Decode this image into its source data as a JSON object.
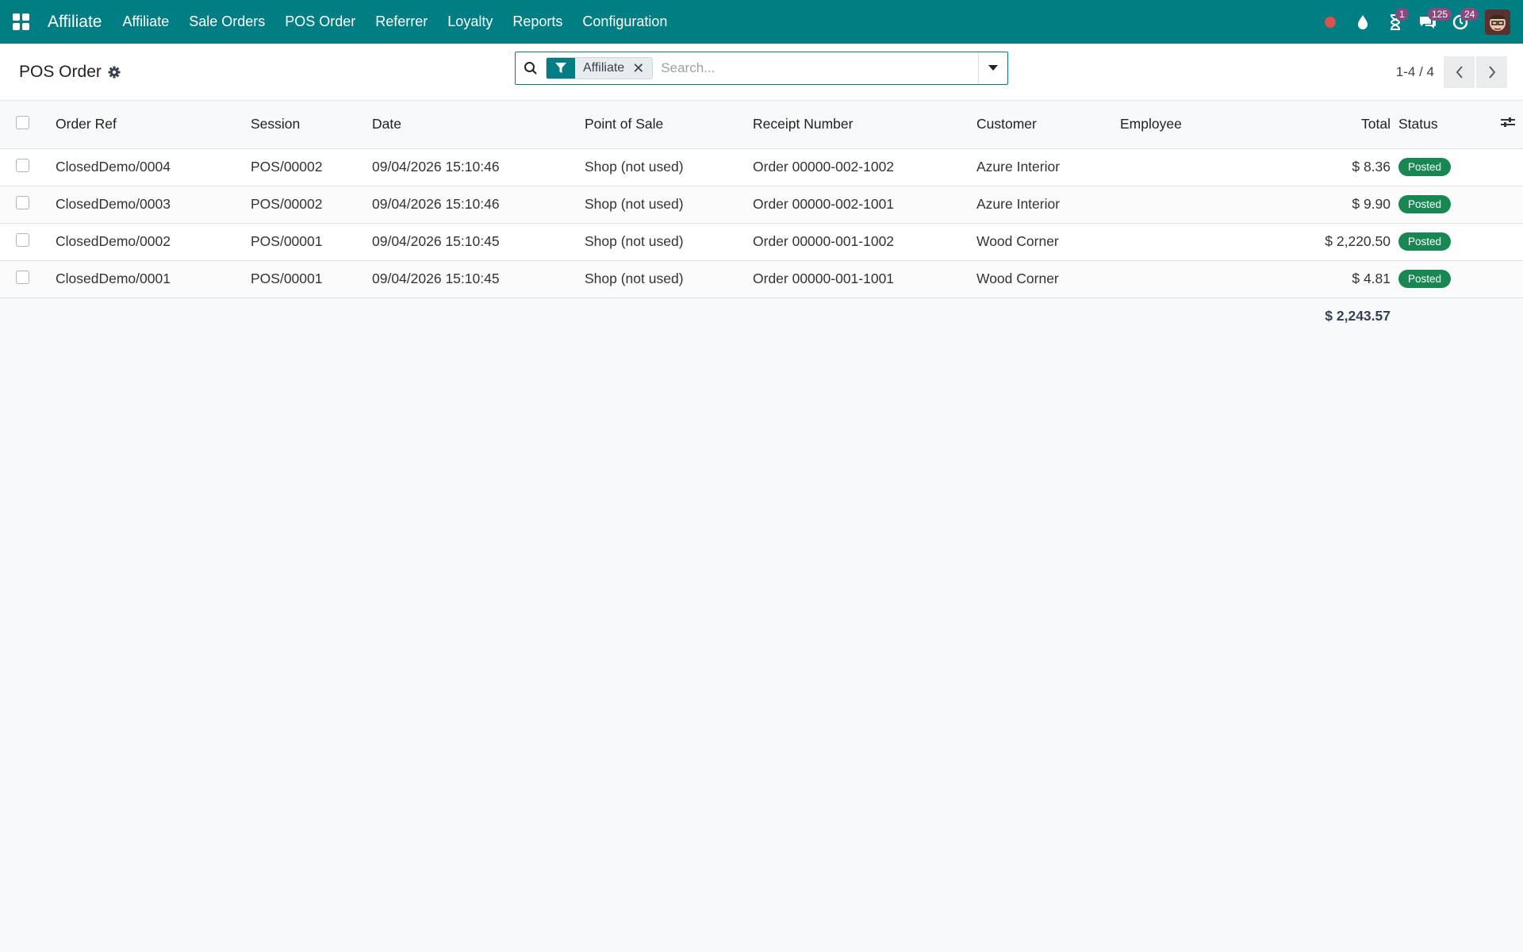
{
  "navbar": {
    "brand": "Affiliate",
    "menu": [
      "Affiliate",
      "Sale Orders",
      "POS Order",
      "Referrer",
      "Loyalty",
      "Reports",
      "Configuration"
    ],
    "activity_badge": "1",
    "messages_badge": "125",
    "activities_badge": "24"
  },
  "control": {
    "title": "POS Order",
    "facet_label": "Affiliate",
    "facet_remove": "✕",
    "search_placeholder": "Search...",
    "pager": "1-4 / 4"
  },
  "table": {
    "columns": [
      "Order Ref",
      "Session",
      "Date",
      "Point of Sale",
      "Receipt Number",
      "Customer",
      "Employee",
      "Total",
      "Status"
    ],
    "rows": [
      {
        "ref": "ClosedDemo/0004",
        "session": "POS/00002",
        "date": "09/04/2026 15:10:46",
        "pos": "Shop (not used)",
        "receipt": "Order 00000-002-1002",
        "customer": "Azure Interior",
        "employee": "",
        "total": "$ 8.36",
        "status": "Posted"
      },
      {
        "ref": "ClosedDemo/0003",
        "session": "POS/00002",
        "date": "09/04/2026 15:10:46",
        "pos": "Shop (not used)",
        "receipt": "Order 00000-002-1001",
        "customer": "Azure Interior",
        "employee": "",
        "total": "$ 9.90",
        "status": "Posted"
      },
      {
        "ref": "ClosedDemo/0002",
        "session": "POS/00001",
        "date": "09/04/2026 15:10:45",
        "pos": "Shop (not used)",
        "receipt": "Order 00000-001-1002",
        "customer": "Wood Corner",
        "employee": "",
        "total": "$ 2,220.50",
        "status": "Posted"
      },
      {
        "ref": "ClosedDemo/0001",
        "session": "POS/00001",
        "date": "09/04/2026 15:10:45",
        "pos": "Shop (not used)",
        "receipt": "Order 00000-001-1001",
        "customer": "Wood Corner",
        "employee": "",
        "total": "$ 4.81",
        "status": "Posted"
      }
    ],
    "grand_total": "$ 2,243.57"
  },
  "colors": {
    "navbar": "#017e84",
    "status_posted": "#198754",
    "badge": "#8a4a7e",
    "recording_dot": "#e74c3c"
  }
}
